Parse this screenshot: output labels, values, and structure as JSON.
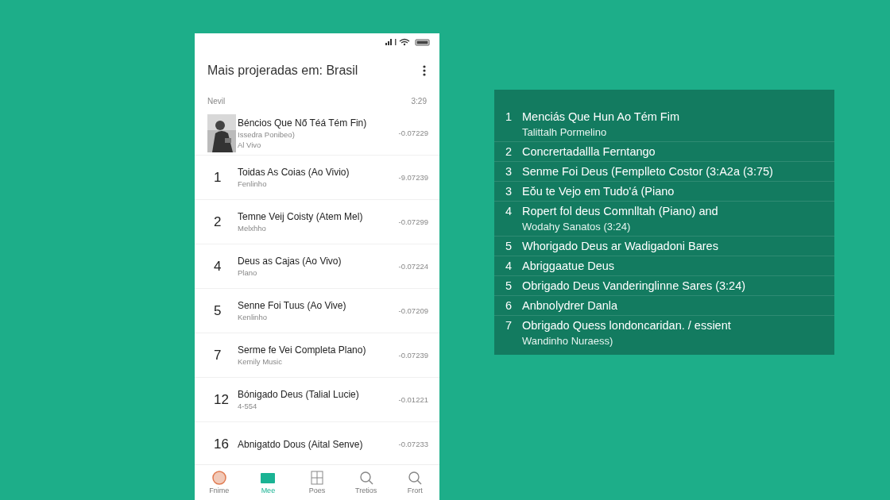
{
  "phone": {
    "title": "Mais projeradas em: Brasil",
    "list_header": {
      "left": "Nevil",
      "right": "3:29"
    },
    "songs": [
      {
        "kind": "thumbnail",
        "title": "Béncios Que Nő Téá Tém Fin)",
        "artist": "Issedra Ponibeo)",
        "extra": "Al Vivo",
        "time": "-0.07229"
      },
      {
        "kind": "ranked",
        "rank": "1",
        "title": "Toidas As Coias (Ao Vivio)",
        "artist": "Fenlinho",
        "time": "-9.07239"
      },
      {
        "kind": "ranked",
        "rank": "2",
        "title": "Temne Veij Coisty (Atem Mel)",
        "artist": "Melxhho",
        "time": "-0.07299"
      },
      {
        "kind": "ranked",
        "rank": "4",
        "title": "Deus as Cajas (Ao Vivo)",
        "artist": "Plano",
        "time": "-0.07224"
      },
      {
        "kind": "ranked",
        "rank": "5",
        "title": "Senne Foi Tuus (Ao Vive)",
        "artist": "Kenlinho",
        "time": "-0.07209"
      },
      {
        "kind": "ranked",
        "rank": "7",
        "title": "Serme fe Vei Completa Plano)",
        "artist": "Kemily Music",
        "time": "-0.07239"
      },
      {
        "kind": "ranked",
        "rank": "12",
        "title": "Bónigado Deus (Talial Lucie)",
        "artist": "4-554",
        "time": "-0.01221"
      },
      {
        "kind": "ranked",
        "rank": "16",
        "title": "Abnigatdo Dous (Aital Senve)",
        "time": "-0.07233"
      }
    ],
    "nav": [
      {
        "kind": "circle",
        "label": "Fnime",
        "selected": false
      },
      {
        "kind": "folder",
        "label": "Mee",
        "selected": true
      },
      {
        "kind": "grid",
        "label": "Poes",
        "selected": false
      },
      {
        "kind": "search",
        "label": "Tretios",
        "selected": false
      },
      {
        "kind": "search",
        "label": "Frort",
        "selected": false
      }
    ]
  },
  "panel": {
    "rows": [
      {
        "rank": "1",
        "title": "Menciás Que Hun Ao Tém Fim",
        "subtitle": "Talittalh Pormelino"
      },
      {
        "rank": "2",
        "title": "Concrertadallla Ferntango"
      },
      {
        "rank": "3",
        "title": "Senme Foi Deus (Femplleto Costor (3:A2a (3:75)"
      },
      {
        "rank": "3",
        "title": "Eǒu te Vejo em Tudo'á (Piano"
      },
      {
        "rank": "4",
        "title": "Ropert fol deus Comnlltah (Piano) and",
        "subtitle": "Wodahy Sanatos (3:24)"
      },
      {
        "rank": "5",
        "title": "Whorigado Deus ar Wadigadoni Bares"
      },
      {
        "rank": "4",
        "title": "Abriggaatue Deus"
      },
      {
        "rank": "5",
        "title": "Obrigado Deus Vanderinglinne Sares (3:24)"
      },
      {
        "rank": "6",
        "title": "Anbnolydrer Danla"
      },
      {
        "rank": "7",
        "title": "Obrigado Quess londoncaridan. / essient",
        "subtitle": "Wandinho Nuraess)"
      }
    ]
  }
}
